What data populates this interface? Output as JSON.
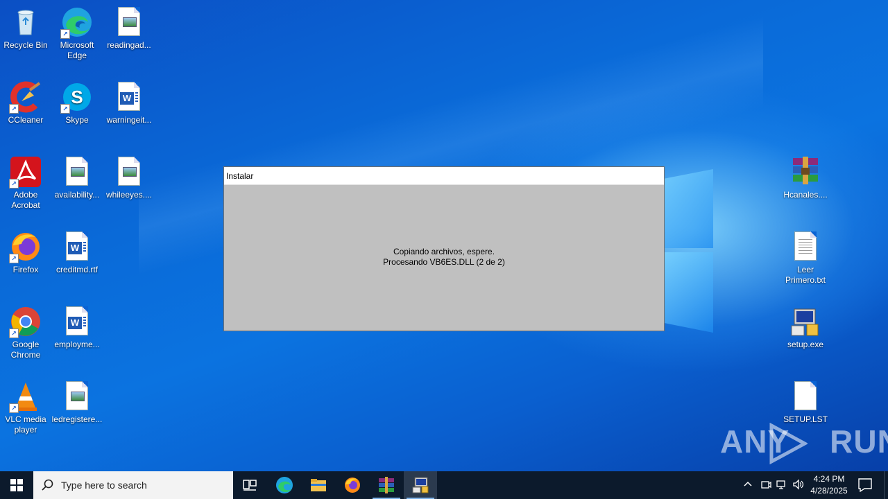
{
  "desktop": {
    "left_icons": [
      {
        "label": "Recycle Bin",
        "icon": "recycle-bin-icon"
      },
      {
        "label": "Microsoft Edge",
        "icon": "edge-icon"
      },
      {
        "label": "readingad...",
        "icon": "image-file-icon"
      },
      {
        "label": "CCleaner",
        "icon": "ccleaner-icon"
      },
      {
        "label": "Skype",
        "icon": "skype-icon"
      },
      {
        "label": "warningeit...",
        "icon": "word-doc-icon"
      },
      {
        "label": "Adobe Acrobat",
        "icon": "acrobat-icon"
      },
      {
        "label": "availability...",
        "icon": "image-file-icon"
      },
      {
        "label": "whileeyes....",
        "icon": "image-file-icon"
      },
      {
        "label": "Firefox",
        "icon": "firefox-icon"
      },
      {
        "label": "creditmd.rtf",
        "icon": "word-doc-icon"
      },
      {
        "label": "Google Chrome",
        "icon": "chrome-icon"
      },
      {
        "label": "employme...",
        "icon": "word-doc-icon"
      },
      {
        "label": "VLC media player",
        "icon": "vlc-icon"
      },
      {
        "label": "ledregistere...",
        "icon": "image-file-icon"
      }
    ],
    "right_icons": [
      {
        "label": "Hcanales....",
        "icon": "winrar-archive-icon"
      },
      {
        "label": "Leer Primero.txt",
        "icon": "text-file-icon"
      },
      {
        "label": "setup.exe",
        "icon": "setup-exe-icon"
      },
      {
        "label": "SETUP.LST",
        "icon": "blank-file-icon"
      }
    ]
  },
  "dialog": {
    "title": "Instalar",
    "line1": "Copiando archivos, espere.",
    "line2": "Procesando VB6ES.DLL (2 de 2)"
  },
  "watermark": {
    "text_left": "ANY",
    "text_right": "RUN"
  },
  "taskbar": {
    "search_placeholder": "Type here to search",
    "pinned": [
      "task-view-icon",
      "edge-icon",
      "file-explorer-icon",
      "firefox-icon",
      "winrar-icon",
      "setup-installer-icon"
    ],
    "clock_time": "4:24 PM",
    "clock_date": "4/28/2025"
  },
  "colors": {
    "taskbar": "#0c1a2c",
    "dialog_bg": "#c0c0c0",
    "desktop": "#0a63d4"
  }
}
